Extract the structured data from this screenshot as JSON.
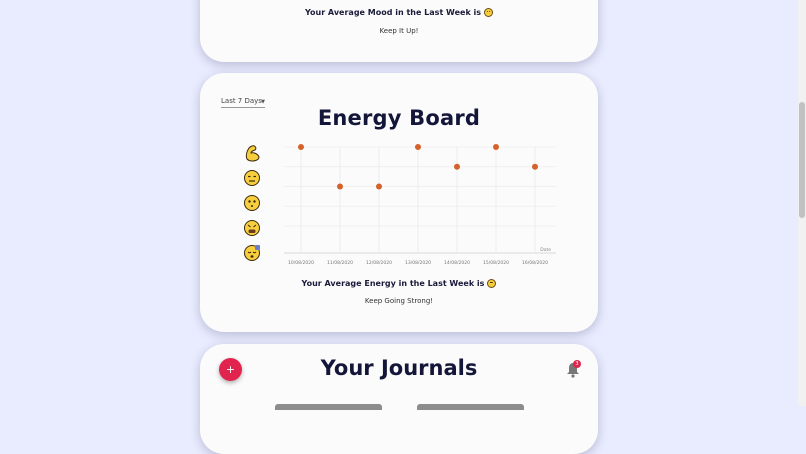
{
  "mood_summary": {
    "heading": "Your Average Mood in the Last Week is",
    "heading_emoji": "slightly-smiling-face-icon",
    "subtext": "Keep It Up!"
  },
  "energy_board": {
    "range_select": {
      "selected": "Last 7 Days"
    },
    "title": "Energy Board",
    "summary_heading": "Your Average Energy in the Last Week is",
    "summary_emoji": "expressionless-face-icon",
    "summary_subtext": "Keep Going Strong!",
    "level_icons": [
      "flexed-biceps-icon",
      "expressionless-face-icon",
      "neutral-face-icon",
      "tired-face-icon",
      "sleeping-face-icon"
    ]
  },
  "chart_data": {
    "type": "scatter",
    "x": [
      "10/08/2020",
      "11/08/2020",
      "12/08/2020",
      "13/08/2020",
      "14/08/2020",
      "15/08/2020",
      "16/08/2020"
    ],
    "values": [
      5,
      3,
      3,
      5,
      4,
      5,
      4
    ],
    "ylim": [
      1,
      5
    ],
    "xlabel": "Date",
    "ylabel": "",
    "grid": true,
    "point_color": "#d4622a"
  },
  "journals": {
    "title": "Your Journals",
    "add_label": "+",
    "notification_count": "3",
    "accent": "#e0244e"
  }
}
